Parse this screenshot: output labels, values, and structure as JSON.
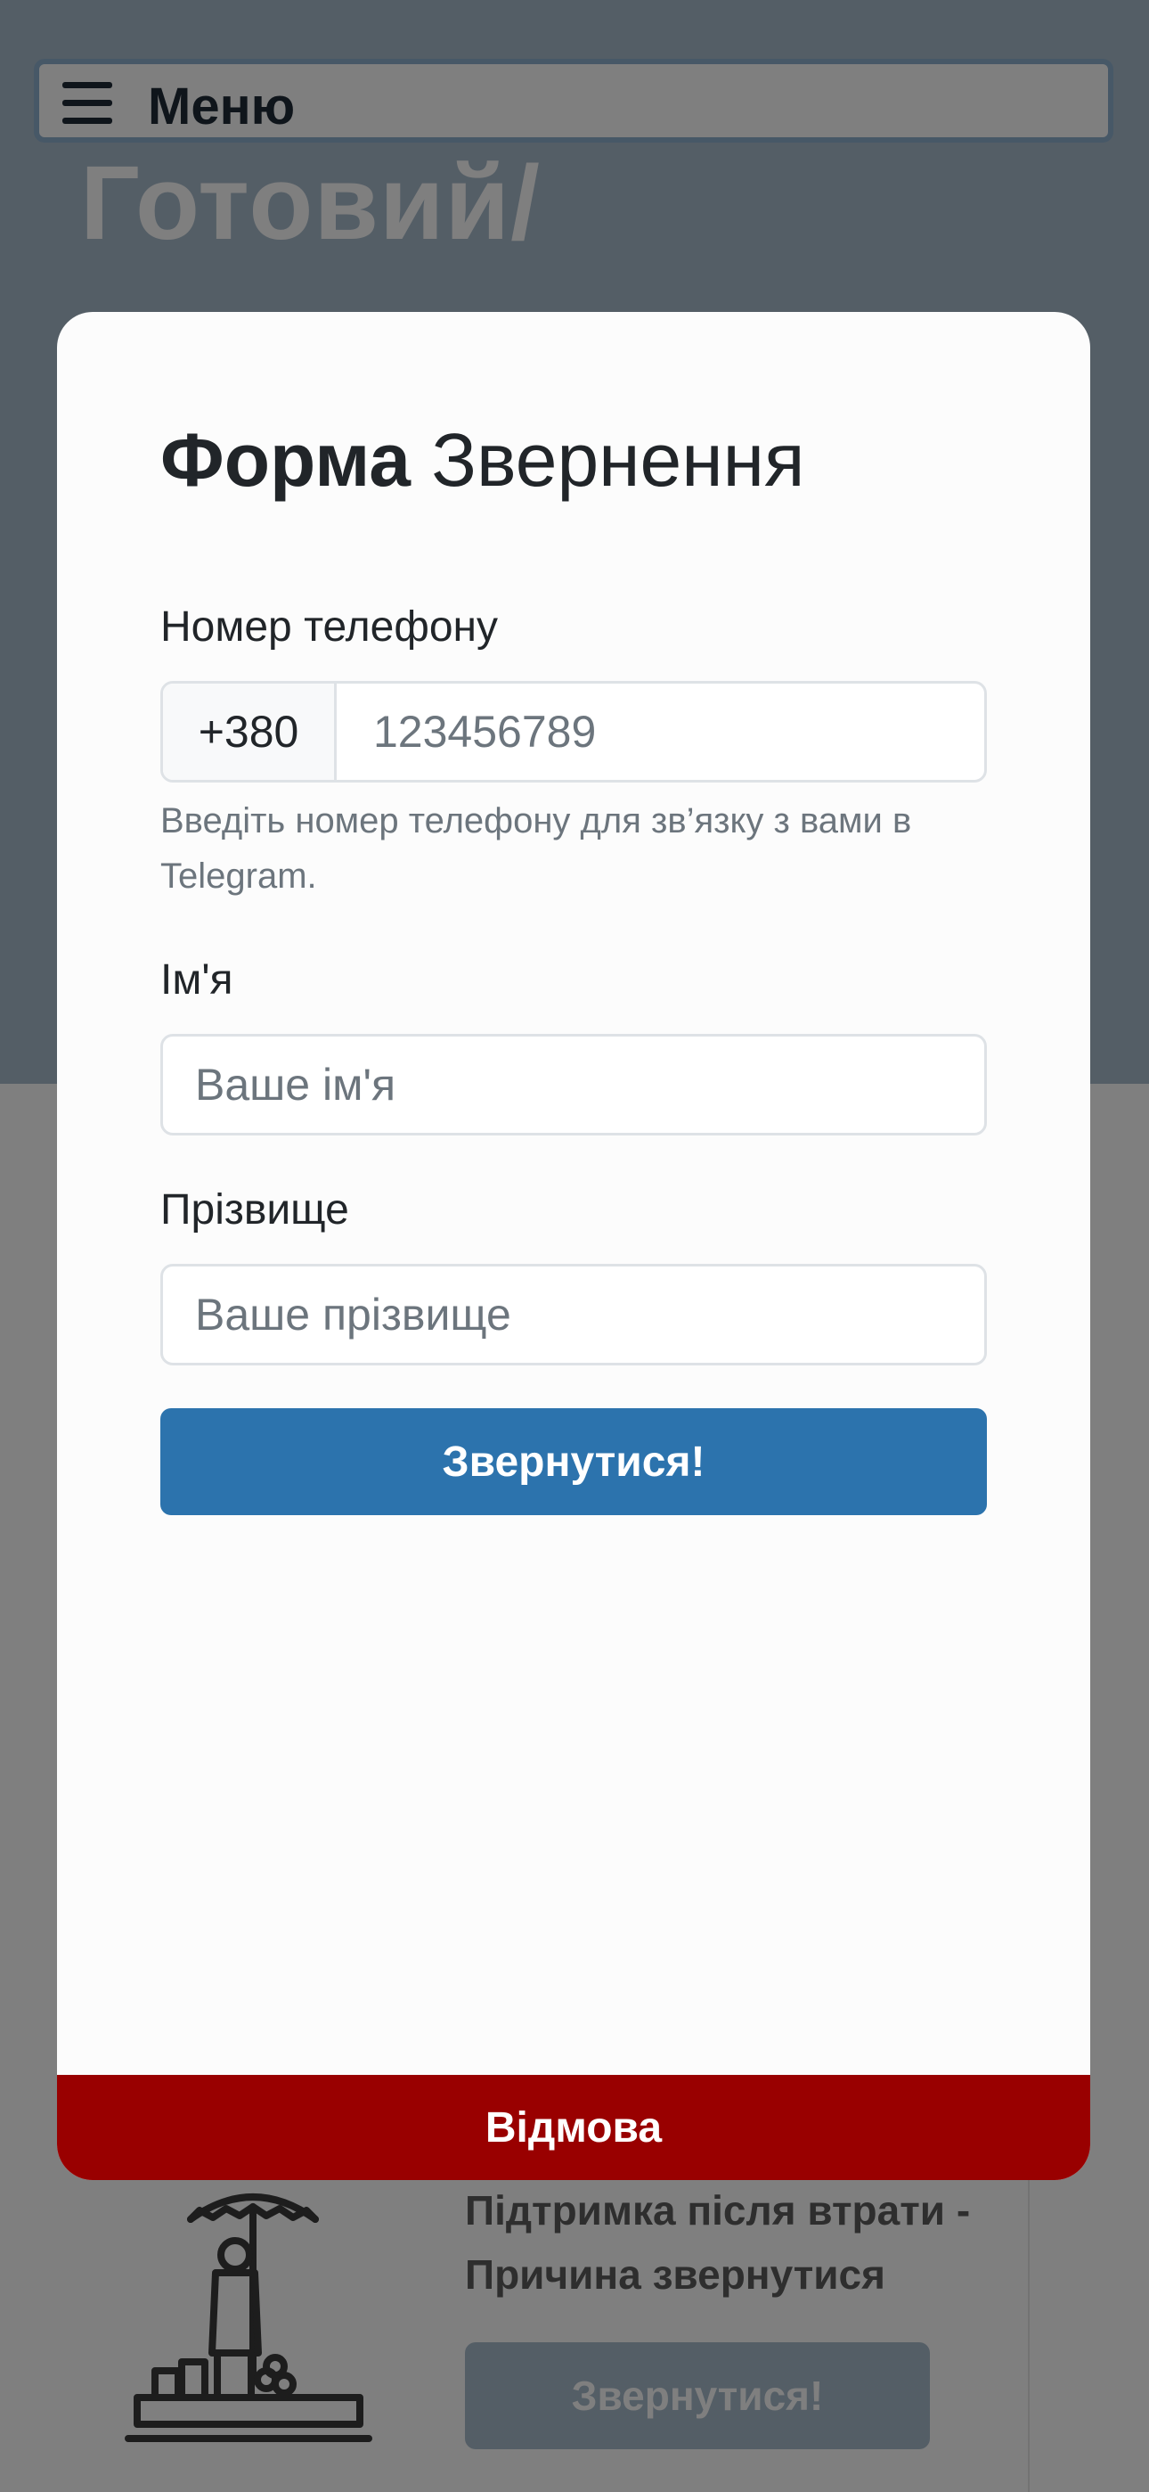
{
  "background": {
    "menu_label": "Меню",
    "hero_title": "Готовий/",
    "support_card": {
      "text": "Підтримка після втрати - Причина звернутися",
      "button_label": "Звернутися!"
    }
  },
  "modal": {
    "title_bold": "Форма",
    "title_regular": "Звернення",
    "phone": {
      "label": "Номер телефону",
      "prefix": "+380",
      "placeholder": "123456789",
      "help": "Введіть номер телефону для зв’язку з вами в Telegram."
    },
    "first_name": {
      "label": "Ім'я",
      "placeholder": "Ваше ім'я"
    },
    "last_name": {
      "label": "Прізвище",
      "placeholder": "Ваше прізвище"
    },
    "submit_label": "Звернутися!",
    "decline_label": "Відмова"
  },
  "colors": {
    "hero_bg": "#a9bccd",
    "primary": "#2c73ad",
    "danger": "#990000",
    "overlay": "rgba(0,0,0,0.5)"
  },
  "icons": {
    "menu": "hamburger-menu-icon",
    "illustration": "person-umbrella-illustration"
  }
}
